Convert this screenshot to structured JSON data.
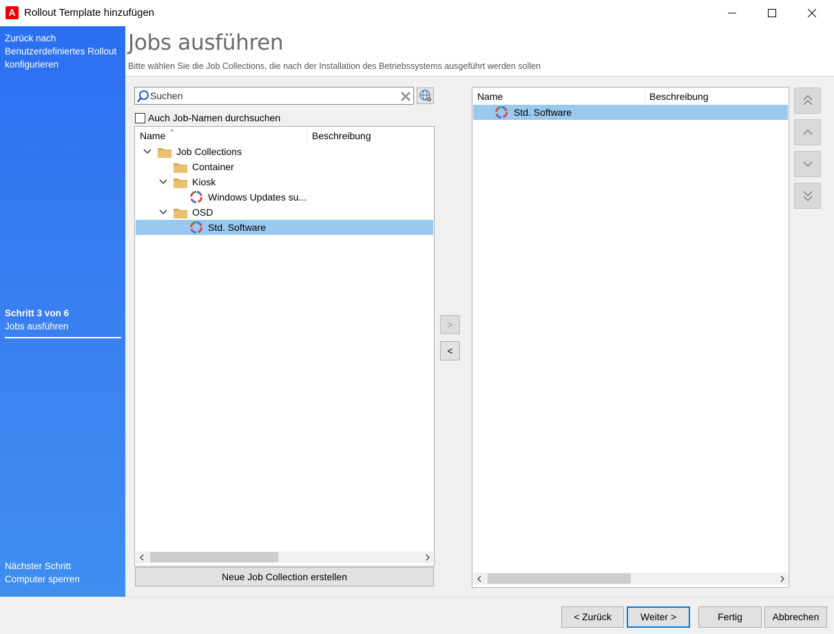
{
  "window": {
    "app_icon_letter": "A",
    "title": "Rollout Template hinzufügen",
    "controls": [
      "minimize-icon",
      "maximize-icon",
      "close-icon"
    ]
  },
  "sidebar": {
    "back_link": "Zurück nach Benutzerdefiniertes Rollout konfigurieren",
    "step_number": "Schritt 3 von 6",
    "step_name": "Jobs ausführen",
    "next_label": "Nächster Schritt",
    "next_name": "Computer sperren"
  },
  "header": {
    "title": "Jobs ausführen",
    "subtitle": "Bitte wählen Sie die Job Collections, die nach der Installation des Betriebssystems ausgeführt werden sollen"
  },
  "search": {
    "placeholder": "Suchen",
    "value": "",
    "checkbox_label": "Auch Job-Namen durchsuchen",
    "checkbox_checked": false
  },
  "left_tree": {
    "columns": [
      "Name",
      "Beschreibung"
    ],
    "sort_indicator": "^",
    "rows": [
      {
        "label": "Job Collections",
        "type": "folder",
        "level": 0,
        "expanded": true,
        "selected": false
      },
      {
        "label": "Container",
        "type": "folder",
        "level": 1,
        "expanded": false,
        "selected": false
      },
      {
        "label": "Kiosk",
        "type": "folder",
        "level": 1,
        "expanded": true,
        "selected": false
      },
      {
        "label": "Windows Updates su...",
        "type": "job",
        "level": 2,
        "selected": false
      },
      {
        "label": "OSD",
        "type": "folder",
        "level": 1,
        "expanded": true,
        "selected": false
      },
      {
        "label": "Std. Software",
        "type": "job",
        "level": 2,
        "selected": true
      }
    ],
    "new_button": "Neue Job Collection erstellen"
  },
  "transfer": {
    "add_label": ">",
    "add_enabled": false,
    "remove_label": "<",
    "remove_enabled": true
  },
  "right_list": {
    "columns": [
      "Name",
      "Beschreibung"
    ],
    "rows": [
      {
        "label": "Std. Software",
        "selected": true
      }
    ]
  },
  "order_buttons": [
    "move-top-icon",
    "move-up-icon",
    "move-down-icon",
    "move-bottom-icon"
  ],
  "footer": {
    "back": "< Zurück",
    "next": "Weiter >",
    "finish": "Fertig",
    "cancel": "Abbrechen"
  },
  "colors": {
    "sidebar": "#2b6ff2",
    "selection": "#99c9ef",
    "default_button_border": "#0078d7"
  }
}
